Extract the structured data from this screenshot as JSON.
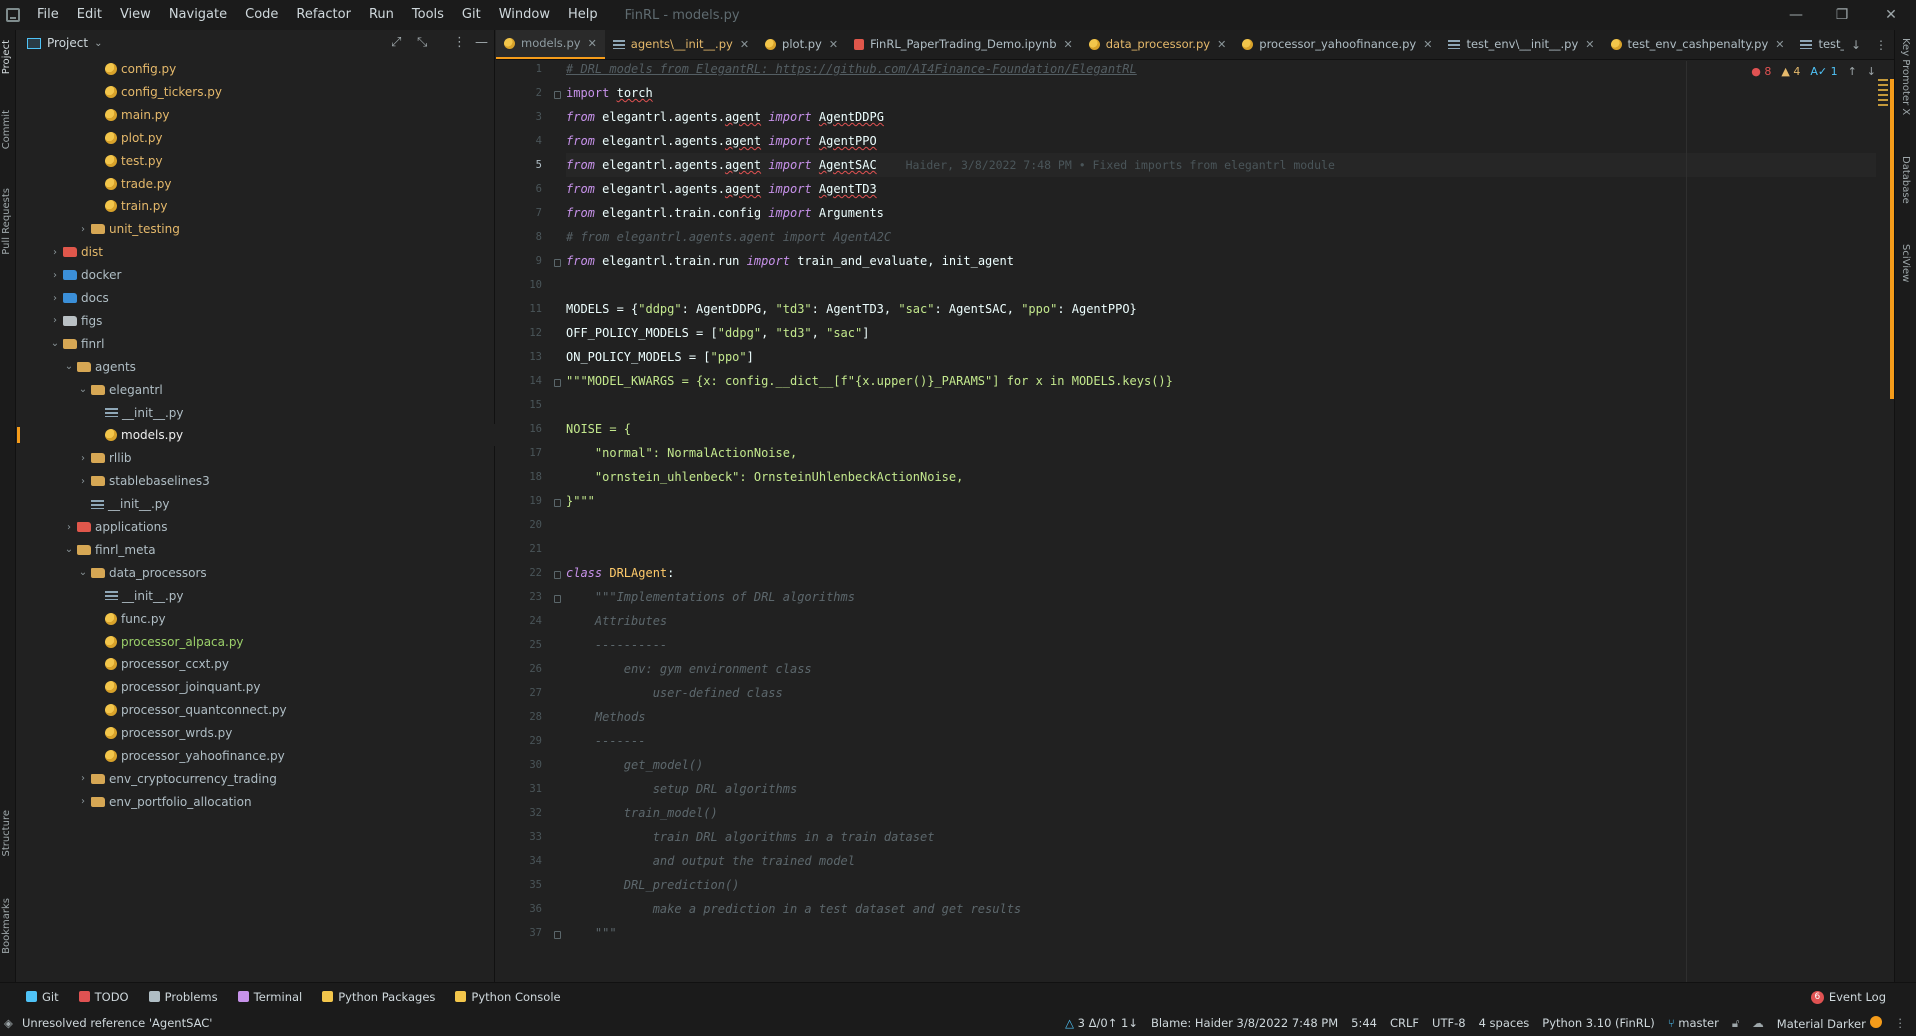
{
  "menubar": {
    "items": [
      "File",
      "Edit",
      "View",
      "Navigate",
      "Code",
      "Refactor",
      "Run",
      "Tools",
      "Git",
      "Window",
      "Help"
    ],
    "window_title": "FinRL - models.py"
  },
  "left_strip": {
    "tabs": [
      "Project",
      "Commit",
      "Pull Requests",
      "Structure",
      "Bookmarks"
    ]
  },
  "project_panel": {
    "title": "Project",
    "tree": [
      {
        "label": "config.py",
        "depth": 5,
        "type": "py",
        "arrow": "",
        "color": "yellow"
      },
      {
        "label": "config_tickers.py",
        "depth": 5,
        "type": "py",
        "arrow": "",
        "color": "yellow"
      },
      {
        "label": "main.py",
        "depth": 5,
        "type": "py",
        "arrow": "",
        "color": "yellow"
      },
      {
        "label": "plot.py",
        "depth": 5,
        "type": "py",
        "arrow": "",
        "color": "yellow"
      },
      {
        "label": "test.py",
        "depth": 5,
        "type": "py",
        "arrow": "",
        "color": "yellow"
      },
      {
        "label": "trade.py",
        "depth": 5,
        "type": "py",
        "arrow": "",
        "color": "yellow"
      },
      {
        "label": "train.py",
        "depth": 5,
        "type": "py",
        "arrow": "",
        "color": "yellow"
      },
      {
        "label": "unit_testing",
        "depth": 4,
        "type": "folder",
        "arrow": "›",
        "color": "yellow"
      },
      {
        "label": "dist",
        "depth": 2,
        "type": "folder-red",
        "arrow": "›",
        "color": "yellow"
      },
      {
        "label": "docker",
        "depth": 2,
        "type": "folder-blue",
        "arrow": "›",
        "color": "normal"
      },
      {
        "label": "docs",
        "depth": 2,
        "type": "folder-blue",
        "arrow": "›",
        "color": "normal"
      },
      {
        "label": "figs",
        "depth": 2,
        "type": "folder-gray",
        "arrow": "›",
        "color": "normal"
      },
      {
        "label": "finrl",
        "depth": 2,
        "type": "folder",
        "arrow": "⌄",
        "color": "normal"
      },
      {
        "label": "agents",
        "depth": 3,
        "type": "folder",
        "arrow": "⌄",
        "color": "normal"
      },
      {
        "label": "elegantrl",
        "depth": 4,
        "type": "folder",
        "arrow": "⌄",
        "color": "normal"
      },
      {
        "label": "__init__.py",
        "depth": 5,
        "type": "init",
        "arrow": "",
        "color": "normal"
      },
      {
        "label": "models.py",
        "depth": 5,
        "type": "py",
        "arrow": "",
        "color": "white",
        "selected": true
      },
      {
        "label": "rllib",
        "depth": 4,
        "type": "folder",
        "arrow": "›",
        "color": "normal"
      },
      {
        "label": "stablebaselines3",
        "depth": 4,
        "type": "folder",
        "arrow": "›",
        "color": "normal"
      },
      {
        "label": "__init__.py",
        "depth": 4,
        "type": "init",
        "arrow": "",
        "color": "normal"
      },
      {
        "label": "applications",
        "depth": 3,
        "type": "folder-red",
        "arrow": "›",
        "color": "normal"
      },
      {
        "label": "finrl_meta",
        "depth": 3,
        "type": "folder",
        "arrow": "⌄",
        "color": "normal"
      },
      {
        "label": "data_processors",
        "depth": 4,
        "type": "folder",
        "arrow": "⌄",
        "color": "normal"
      },
      {
        "label": "__init__.py",
        "depth": 5,
        "type": "init",
        "arrow": "",
        "color": "normal"
      },
      {
        "label": "func.py",
        "depth": 5,
        "type": "py",
        "arrow": "",
        "color": "normal"
      },
      {
        "label": "processor_alpaca.py",
        "depth": 5,
        "type": "py",
        "arrow": "",
        "color": "green"
      },
      {
        "label": "processor_ccxt.py",
        "depth": 5,
        "type": "py",
        "arrow": "",
        "color": "normal"
      },
      {
        "label": "processor_joinquant.py",
        "depth": 5,
        "type": "py",
        "arrow": "",
        "color": "normal"
      },
      {
        "label": "processor_quantconnect.py",
        "depth": 5,
        "type": "py",
        "arrow": "",
        "color": "normal"
      },
      {
        "label": "processor_wrds.py",
        "depth": 5,
        "type": "py",
        "arrow": "",
        "color": "normal"
      },
      {
        "label": "processor_yahoofinance.py",
        "depth": 5,
        "type": "py",
        "arrow": "",
        "color": "normal"
      },
      {
        "label": "env_cryptocurrency_trading",
        "depth": 4,
        "type": "folder",
        "arrow": "›",
        "color": "normal"
      },
      {
        "label": "env_portfolio_allocation",
        "depth": 4,
        "type": "folder",
        "arrow": "›",
        "color": "normal"
      }
    ]
  },
  "tabs": [
    {
      "label": "models.py",
      "icon": "py",
      "active": true,
      "color": "normal"
    },
    {
      "label": "agents\\__init__.py",
      "icon": "init",
      "active": false,
      "color": "orange"
    },
    {
      "label": "plot.py",
      "icon": "py",
      "active": false,
      "color": "normal"
    },
    {
      "label": "FinRL_PaperTrading_Demo.ipynb",
      "icon": "nb",
      "active": false,
      "color": "normal"
    },
    {
      "label": "data_processor.py",
      "icon": "py",
      "active": false,
      "color": "orange"
    },
    {
      "label": "processor_yahoofinance.py",
      "icon": "py",
      "active": false,
      "color": "normal"
    },
    {
      "label": "test_env\\__init__.py",
      "icon": "init",
      "active": false,
      "color": "normal"
    },
    {
      "label": "test_env_cashpenalty.py",
      "icon": "py",
      "active": false,
      "color": "normal"
    },
    {
      "label": "test_marketdata",
      "icon": "init",
      "active": false,
      "color": "normal",
      "noclose": true
    }
  ],
  "inspection": {
    "errors": "8",
    "warnings": "4",
    "typos": "1"
  },
  "editor": {
    "current_line": 5,
    "blame_inline": "Haider, 3/8/2022 7:48 PM • Fixed imports from elegantrl module",
    "lines": [
      [
        {
          "t": "# DRL models from ElegantRL: https://github.com/AI4Finance-Foundation/ElegantRL",
          "c": "cm-u"
        }
      ],
      [
        {
          "t": "import",
          "c": "kw2"
        },
        {
          "t": " "
        },
        {
          "t": "torch",
          "c": "err"
        }
      ],
      [
        {
          "t": "from",
          "c": "kw"
        },
        {
          "t": " elegantrl.agents."
        },
        {
          "t": "agent",
          "c": "err"
        },
        {
          "t": " "
        },
        {
          "t": "import",
          "c": "kw"
        },
        {
          "t": " "
        },
        {
          "t": "AgentDDPG",
          "c": "err"
        }
      ],
      [
        {
          "t": "from",
          "c": "kw"
        },
        {
          "t": " elegantrl.agents."
        },
        {
          "t": "agent",
          "c": "err"
        },
        {
          "t": " "
        },
        {
          "t": "import",
          "c": "kw"
        },
        {
          "t": " "
        },
        {
          "t": "AgentPPO",
          "c": "err"
        }
      ],
      [
        {
          "t": "from",
          "c": "kw"
        },
        {
          "t": " elegantrl.agents."
        },
        {
          "t": "agent",
          "c": "err"
        },
        {
          "t": " "
        },
        {
          "t": "import",
          "c": "kw"
        },
        {
          "t": " "
        },
        {
          "t": "AgentSAC",
          "c": "err"
        },
        {
          "t": "    "
        },
        {
          "blame": true
        }
      ],
      [
        {
          "t": "from",
          "c": "kw"
        },
        {
          "t": " elegantrl.agents."
        },
        {
          "t": "agent",
          "c": "err"
        },
        {
          "t": " "
        },
        {
          "t": "import",
          "c": "kw"
        },
        {
          "t": " "
        },
        {
          "t": "AgentTD3",
          "c": "err"
        }
      ],
      [
        {
          "t": "from",
          "c": "kw"
        },
        {
          "t": " elegantrl.train.config "
        },
        {
          "t": "import",
          "c": "kw"
        },
        {
          "t": " Arguments"
        }
      ],
      [
        {
          "t": "# from elegantrl.agents.agent import AgentA2C",
          "c": "cm"
        }
      ],
      [
        {
          "t": "from",
          "c": "kw"
        },
        {
          "t": " elegantrl.train.run "
        },
        {
          "t": "import",
          "c": "kw"
        },
        {
          "t": " train_and_evaluate, init_agent"
        }
      ],
      [
        {
          "t": ""
        }
      ],
      [
        {
          "t": "MODELS = {"
        },
        {
          "t": "\"ddpg\"",
          "c": "str"
        },
        {
          "t": ": AgentDDPG, "
        },
        {
          "t": "\"td3\"",
          "c": "str"
        },
        {
          "t": ": AgentTD3, "
        },
        {
          "t": "\"sac\"",
          "c": "str"
        },
        {
          "t": ": AgentSAC, "
        },
        {
          "t": "\"ppo\"",
          "c": "str"
        },
        {
          "t": ": AgentPPO}"
        }
      ],
      [
        {
          "t": "OFF_POLICY_MODELS = ["
        },
        {
          "t": "\"ddpg\"",
          "c": "str"
        },
        {
          "t": ", "
        },
        {
          "t": "\"td3\"",
          "c": "str"
        },
        {
          "t": ", "
        },
        {
          "t": "\"sac\"",
          "c": "str"
        },
        {
          "t": "]"
        }
      ],
      [
        {
          "t": "ON_POLICY_MODELS = ["
        },
        {
          "t": "\"ppo\"",
          "c": "str"
        },
        {
          "t": "]"
        }
      ],
      [
        {
          "t": "\"\"\"MODEL_KWARGS = {x: config.__dict__[f\"{x.upper()}_PARAMS\"] for x in MODELS.keys()}",
          "c": "str"
        }
      ],
      [
        {
          "t": ""
        }
      ],
      [
        {
          "t": "NOISE = {",
          "c": "str"
        }
      ],
      [
        {
          "t": "    \"normal\": NormalActionNoise,",
          "c": "str"
        }
      ],
      [
        {
          "t": "    \"ornstein_uhlenbeck\": OrnsteinUhlenbeckActionNoise,",
          "c": "str"
        }
      ],
      [
        {
          "t": "}\"\"\"",
          "c": "str"
        }
      ],
      [
        {
          "t": ""
        }
      ],
      [
        {
          "t": ""
        }
      ],
      [
        {
          "t": "class",
          "c": "kw"
        },
        {
          "t": " "
        },
        {
          "t": "DRLAgent",
          "c": "cls"
        },
        {
          "t": ":"
        }
      ],
      [
        {
          "t": "    \"\"\"Implementations of DRL algorithms",
          "c": "doc"
        }
      ],
      [
        {
          "t": "    Attributes",
          "c": "doc"
        }
      ],
      [
        {
          "t": "    ----------",
          "c": "doc"
        }
      ],
      [
        {
          "t": "        env: gym environment class",
          "c": "doc"
        }
      ],
      [
        {
          "t": "            user-defined class",
          "c": "doc"
        }
      ],
      [
        {
          "t": "    Methods",
          "c": "doc"
        }
      ],
      [
        {
          "t": "    -------",
          "c": "doc"
        }
      ],
      [
        {
          "t": "        get_model()",
          "c": "doc"
        }
      ],
      [
        {
          "t": "            setup DRL algorithms",
          "c": "doc"
        }
      ],
      [
        {
          "t": "        train_model()",
          "c": "doc"
        }
      ],
      [
        {
          "t": "            train DRL algorithms in a train dataset",
          "c": "doc"
        }
      ],
      [
        {
          "t": "            and output the trained model",
          "c": "doc"
        }
      ],
      [
        {
          "t": "        DRL_prediction()",
          "c": "doc"
        }
      ],
      [
        {
          "t": "            make a prediction in a test dataset and get results",
          "c": "doc"
        }
      ],
      [
        {
          "t": "    \"\"\"",
          "c": "doc"
        }
      ]
    ]
  },
  "right_strip": {
    "tabs": [
      "Key Promoter X",
      "Database",
      "SciView"
    ]
  },
  "bottom_tools": [
    {
      "label": "Git",
      "color": "#4fc3f7"
    },
    {
      "label": "TODO",
      "color": "#e05252"
    },
    {
      "label": "Problems",
      "color": "#b0bec5"
    },
    {
      "label": "Terminal",
      "color": "#c792ea"
    },
    {
      "label": "Python Packages",
      "color": "#f3c64b"
    },
    {
      "label": "Python Console",
      "color": "#f3c64b"
    }
  ],
  "event_log": {
    "label": "Event Log",
    "count": "6"
  },
  "status": {
    "message": "Unresolved reference 'AgentSAC'",
    "vcs_changes": "3 Δ/0↑ 1↓",
    "blame": "Blame: Haider 3/8/2022 7:48 PM",
    "position": "5:44",
    "line_sep": "CRLF",
    "encoding": "UTF-8",
    "indent": "4 spaces",
    "interpreter": "Python 3.10 (FinRL)",
    "branch": "master",
    "theme": "Material Darker"
  },
  "colors": {
    "accent": "#f59c1a",
    "error": "#e05252",
    "keyword": "#c792ea",
    "string": "#c3e88d"
  }
}
